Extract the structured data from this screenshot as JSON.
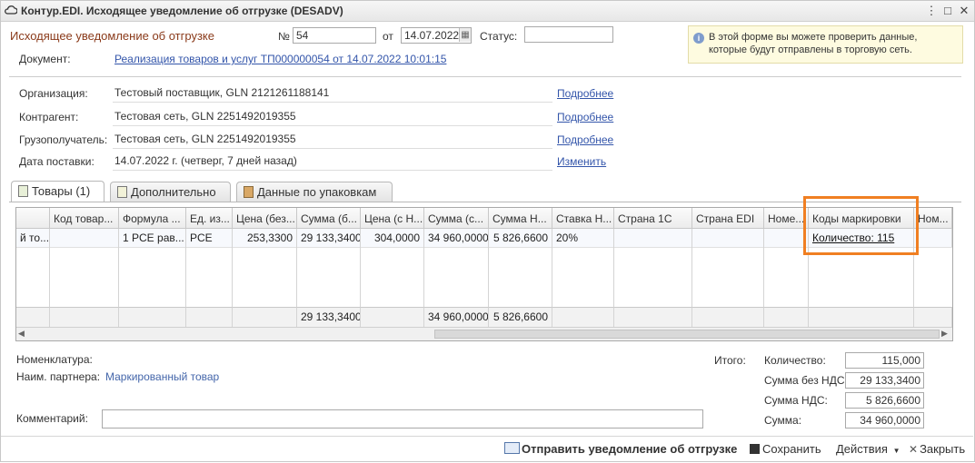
{
  "window": {
    "title": "Контур.EDI. Исходящее уведомление об отгрузке (DESADV)"
  },
  "header": {
    "form_title": "Исходящее уведомление об отгрузке",
    "number_label": "№",
    "number_value": "54",
    "date_label": "от",
    "date_value": "14.07.2022",
    "status_label": "Статус:",
    "status_value": "",
    "document_label": "Документ:",
    "document_link": "Реализация товаров и услуг ТП000000054 от 14.07.2022 10:01:15",
    "hint": "В этой форме вы можете проверить данные, которые будут отправлены в торговую сеть."
  },
  "info": [
    {
      "label": "Организация:",
      "value": "Тестовый поставщик, GLN 2121261188141",
      "link": "Подробнее"
    },
    {
      "label": "Контрагент:",
      "value": "Тестовая сеть, GLN 2251492019355",
      "link": "Подробнее"
    },
    {
      "label": "Грузополучатель:",
      "value": "Тестовая сеть, GLN 2251492019355",
      "link": "Подробнее"
    },
    {
      "label": "Дата поставки:",
      "value": "14.07.2022 г. (четверг, 7 дней назад)",
      "link": "Изменить"
    }
  ],
  "tabs": [
    {
      "label": "Товары (1)"
    },
    {
      "label": "Дополнительно"
    },
    {
      "label": "Данные по упаковкам"
    }
  ],
  "grid": {
    "columns": [
      "",
      "Код товар...",
      "Формула ...",
      "Ед. из...",
      "Цена (без...",
      "Сумма (б...",
      "Цена (с Н...",
      "Сумма (с...",
      "Сумма Н...",
      "Ставка Н...",
      "Страна 1С",
      "Страна EDI",
      "Номе...",
      "Коды маркировки",
      "Ном..."
    ],
    "row": [
      "й то...",
      "",
      "1 PCE рав...",
      "PCE",
      "253,3300",
      "29 133,3400",
      "304,0000",
      "34 960,0000",
      "5 826,6600",
      "20%",
      "",
      "",
      "",
      "Количество: 115",
      ""
    ],
    "totals": [
      "",
      "",
      "",
      "",
      "",
      "29 133,3400",
      "",
      "34 960,0000",
      "5 826,6600",
      "",
      "",
      "",
      "",
      "",
      ""
    ]
  },
  "details": {
    "nomenclature_label": "Номенклатура:",
    "partner_name_label": "Наим. партнера:",
    "partner_name_value": "Маркированный товар",
    "comment_label": "Комментарий:",
    "comment_value": ""
  },
  "totals": {
    "label": "Итого:",
    "qty_label": "Количество:",
    "qty_value": "115,000",
    "sum_wo_vat_label": "Сумма без НДС:",
    "sum_wo_vat_value": "29 133,3400",
    "vat_label": "Сумма НДС:",
    "vat_value": "5 826,6600",
    "sum_label": "Сумма:",
    "sum_value": "34 960,0000"
  },
  "actions": {
    "send": "Отправить уведомление об отгрузке",
    "save": "Сохранить",
    "actions_menu": "Действия",
    "close": "Закрыть"
  },
  "colors": {
    "highlight": "#f07f22",
    "link": "#3355aa",
    "title": "#8a3a1a"
  }
}
